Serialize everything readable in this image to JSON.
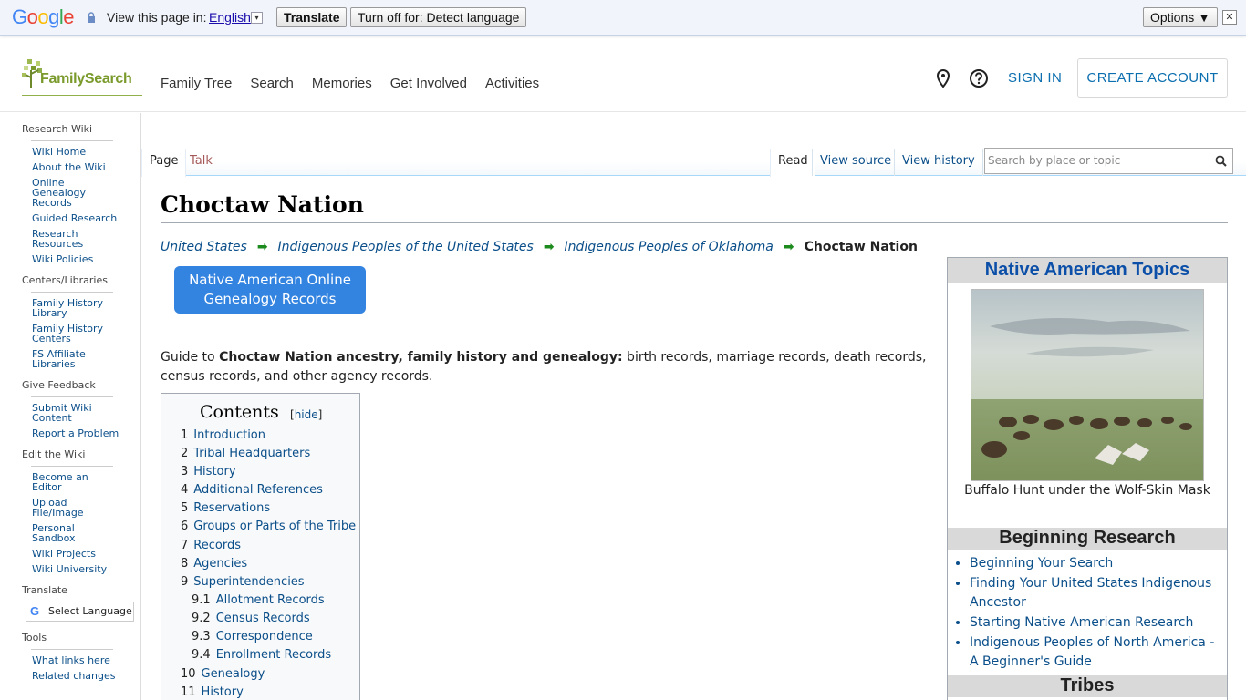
{
  "google_bar": {
    "logo": "Google",
    "view_in": "View this page in:",
    "language": "English",
    "language_arrow": "▾",
    "translate_button": "Translate",
    "turn_off_button": "Turn off for: Detect language",
    "options_button": "Options ▼",
    "close": "✕"
  },
  "header": {
    "logo_text": "FamilySearch",
    "nav": [
      "Family Tree",
      "Search",
      "Memories",
      "Get Involved",
      "Activities"
    ],
    "sign_in": "SIGN IN",
    "create_account": "CREATE ACCOUNT"
  },
  "sidebar": {
    "sections": [
      {
        "heading": "Research Wiki",
        "items": [
          "Wiki Home",
          "About the Wiki",
          "Online Genealogy Records",
          "Guided Research",
          "Research Resources",
          "Wiki Policies"
        ]
      },
      {
        "heading": "Centers/Libraries",
        "items": [
          "Family History Library",
          "Family History Centers",
          "FS Affiliate Libraries"
        ]
      },
      {
        "heading": "Give Feedback",
        "items": [
          "Submit Wiki Content",
          "Report a Problem"
        ]
      },
      {
        "heading": "Edit the Wiki",
        "items": [
          "Become an Editor",
          "Upload File/Image",
          "Personal Sandbox",
          "Wiki Projects",
          "Wiki University"
        ]
      },
      {
        "heading": "Translate",
        "items": []
      },
      {
        "heading": "Tools",
        "items": [
          "What links here",
          "Related changes"
        ]
      }
    ],
    "select_language": "Select Language"
  },
  "tabs": {
    "page": "Page",
    "talk": "Talk",
    "read": "Read",
    "view_source": "View source",
    "view_history": "View history"
  },
  "search": {
    "placeholder": "Search by place or topic"
  },
  "page": {
    "title": "Choctaw Nation",
    "breadcrumb": [
      "United States",
      "Indigenous Peoples of the United States",
      "Indigenous Peoples of Oklahoma"
    ],
    "breadcrumb_current": "Choctaw Nation",
    "native_button": "Native American Online Genealogy Records",
    "intro_prefix": "Guide to ",
    "intro_bold": "Choctaw Nation ancestry, family history and genealogy:",
    "intro_rest": " birth records, marriage records, death records, census records, and other agency records."
  },
  "toc": {
    "title": "Contents",
    "hide_open": "[",
    "hide_label": "hide",
    "hide_close": "]",
    "items": [
      {
        "num": "1",
        "label": "Introduction",
        "sub": false
      },
      {
        "num": "2",
        "label": "Tribal Headquarters",
        "sub": false
      },
      {
        "num": "3",
        "label": "History",
        "sub": false
      },
      {
        "num": "4",
        "label": "Additional References",
        "sub": false
      },
      {
        "num": "5",
        "label": "Reservations",
        "sub": false
      },
      {
        "num": "6",
        "label": "Groups or Parts of the Tribe",
        "sub": false
      },
      {
        "num": "7",
        "label": "Records",
        "sub": false
      },
      {
        "num": "8",
        "label": "Agencies",
        "sub": false
      },
      {
        "num": "9",
        "label": "Superintendencies",
        "sub": false
      },
      {
        "num": "9.1",
        "label": "Allotment Records",
        "sub": true
      },
      {
        "num": "9.2",
        "label": "Census Records",
        "sub": true
      },
      {
        "num": "9.3",
        "label": "Correspondence",
        "sub": true
      },
      {
        "num": "9.4",
        "label": "Enrollment Records",
        "sub": true
      },
      {
        "num": "10",
        "label": "Genealogy",
        "sub": false
      },
      {
        "num": "11",
        "label": "History",
        "sub": false
      }
    ]
  },
  "infobox": {
    "heading": "Native American Topics",
    "caption": "Buffalo Hunt under the Wolf-Skin Mask",
    "section_beginning": "Beginning Research",
    "beginning_links": [
      "Beginning Your Search",
      "Finding Your United States Indigenous Ancestor",
      "Starting Native American Research",
      "Indigenous Peoples of North America - A Beginner's Guide"
    ],
    "section_tribes": "Tribes"
  }
}
